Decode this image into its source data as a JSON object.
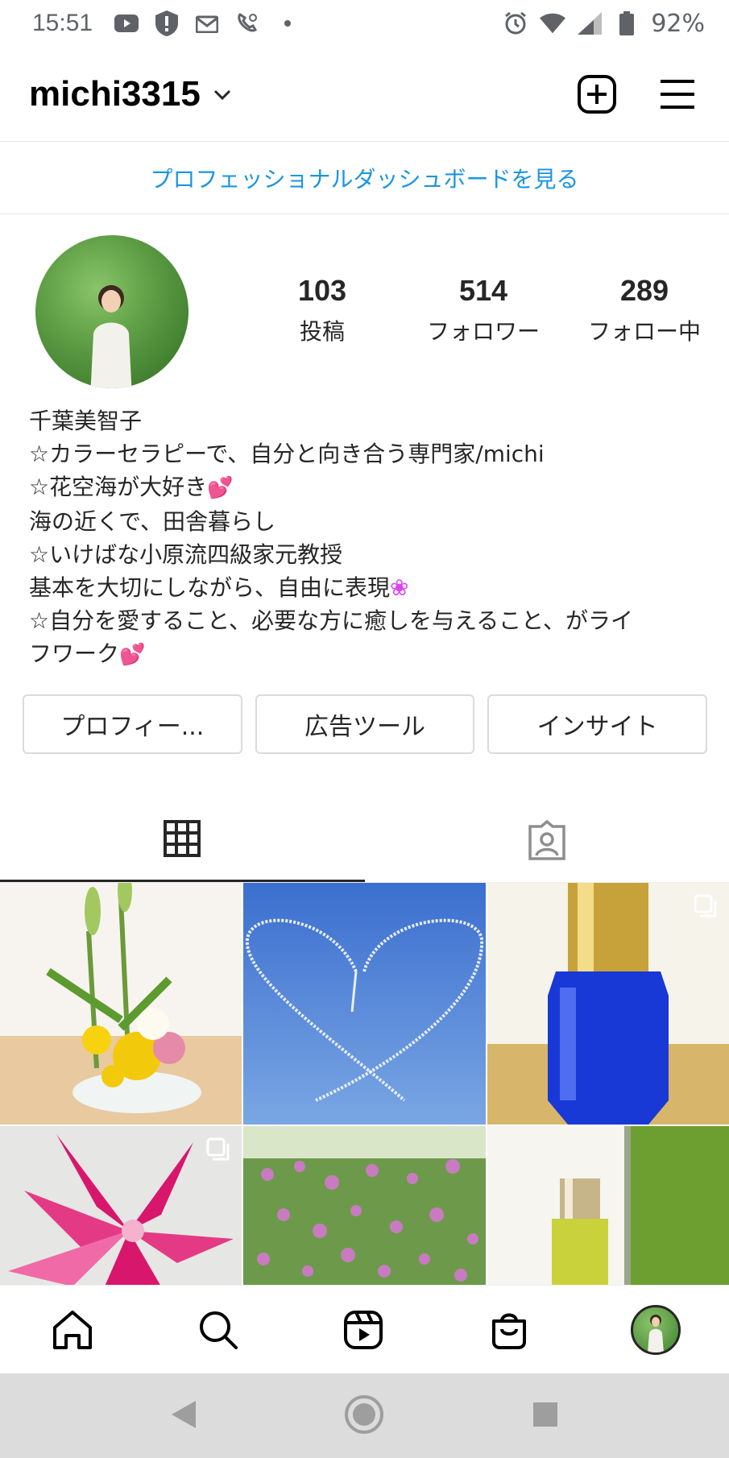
{
  "status_bar": {
    "time": "15:51",
    "battery": "92%",
    "left_icons": [
      "youtube-icon",
      "alert-shield-icon",
      "mail-icon",
      "call-icon",
      "dot-icon"
    ],
    "right_icons": [
      "alarm-icon",
      "wifi-icon",
      "signal-icon",
      "battery-icon"
    ]
  },
  "header": {
    "username": "michi3315",
    "icons": [
      "chevron-down-icon",
      "add-post-icon",
      "menu-icon"
    ]
  },
  "dashboard_link": "プロフェッショナルダッシュボードを見る",
  "profile": {
    "stats": [
      {
        "value": "103",
        "label": "投稿"
      },
      {
        "value": "514",
        "label": "フォロワー"
      },
      {
        "value": "289",
        "label": "フォロー中"
      }
    ],
    "bio": {
      "line1": "千葉美智子",
      "line2": "☆カラーセラピーで、自分と向き合う専門家/michi",
      "line3": "☆花空海が大好き",
      "line4": "海の近くで、田舎暮らし",
      "line5": "☆いけばな小原流四級家元教授",
      "line6": "基本を大切にしながら、自由に表現",
      "line7": "☆自分を愛すること、必要な方に癒しを与えること、がライ",
      "line8": "フワーク"
    },
    "emoji": {
      "hearts": "💕",
      "flower": "❀"
    }
  },
  "buttons": {
    "edit_profile": "プロフィー...",
    "ad_tools": "広告ツール",
    "insights": "インサイト"
  },
  "tabs": [
    "grid-icon",
    "tagged-icon"
  ],
  "posts": [
    {
      "subject": "flower-arrangement",
      "multiple": false
    },
    {
      "subject": "sky-heart",
      "multiple": false
    },
    {
      "subject": "blue-bottle",
      "multiple": true
    },
    {
      "subject": "pink-lily",
      "multiple": true
    },
    {
      "subject": "pink-flowers-bush",
      "multiple": false
    },
    {
      "subject": "yellow-bottle",
      "multiple": false
    }
  ],
  "bottom_nav": [
    "home-icon",
    "search-icon",
    "reels-icon",
    "shop-icon",
    "profile-avatar"
  ],
  "system_nav": [
    "back-icon",
    "home-circle-icon",
    "recents-icon"
  ],
  "colors": {
    "link_blue": "#1b95e0",
    "text": "#262626",
    "border": "#dbdbdb"
  }
}
